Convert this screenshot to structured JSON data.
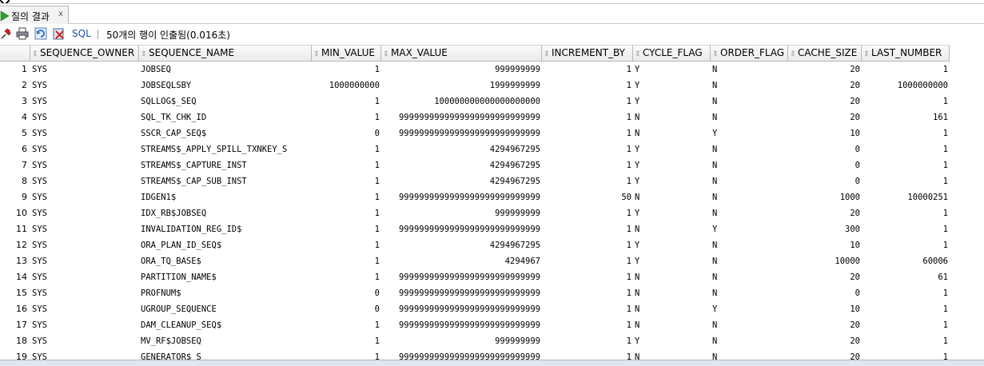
{
  "tab": {
    "title": "질의 결과",
    "close": "x"
  },
  "toolbar": {
    "sql_label": "SQL",
    "status": "50개의 행이 인출됨(0.016초)"
  },
  "columns": [
    {
      "key": "rownum",
      "label": ""
    },
    {
      "key": "owner",
      "label": "SEQUENCE_OWNER"
    },
    {
      "key": "name",
      "label": "SEQUENCE_NAME"
    },
    {
      "key": "min",
      "label": "MIN_VALUE"
    },
    {
      "key": "max",
      "label": "MAX_VALUE"
    },
    {
      "key": "inc",
      "label": "INCREMENT_BY"
    },
    {
      "key": "cycle",
      "label": "CYCLE_FLAG"
    },
    {
      "key": "order",
      "label": "ORDER_FLAG"
    },
    {
      "key": "cache",
      "label": "CACHE_SIZE"
    },
    {
      "key": "last",
      "label": "LAST_NUMBER"
    }
  ],
  "rows": [
    [
      "1",
      "SYS",
      "JOBSEQ",
      "1",
      "999999999",
      "1",
      "Y",
      "N",
      "20",
      "1"
    ],
    [
      "2",
      "SYS",
      "JOBSEQLSBY",
      "1000000000",
      "1999999999",
      "1",
      "Y",
      "N",
      "20",
      "1000000000"
    ],
    [
      "3",
      "SYS",
      "SQLLOG$_SEQ",
      "1",
      "100000000000000000000",
      "1",
      "Y",
      "N",
      "20",
      "1"
    ],
    [
      "4",
      "SYS",
      "SQL_TK_CHK_ID",
      "1",
      "9999999999999999999999999999",
      "1",
      "N",
      "N",
      "20",
      "161"
    ],
    [
      "5",
      "SYS",
      "SSCR_CAP_SEQ$",
      "0",
      "9999999999999999999999999999",
      "1",
      "N",
      "Y",
      "10",
      "1"
    ],
    [
      "6",
      "SYS",
      "STREAMS$_APPLY_SPILL_TXNKEY_S",
      "1",
      "4294967295",
      "1",
      "Y",
      "N",
      "0",
      "1"
    ],
    [
      "7",
      "SYS",
      "STREAMS$_CAPTURE_INST",
      "1",
      "4294967295",
      "1",
      "Y",
      "N",
      "0",
      "1"
    ],
    [
      "8",
      "SYS",
      "STREAMS$_CAP_SUB_INST",
      "1",
      "4294967295",
      "1",
      "Y",
      "N",
      "0",
      "1"
    ],
    [
      "9",
      "SYS",
      "IDGEN1$",
      "1",
      "9999999999999999999999999999",
      "50",
      "N",
      "N",
      "1000",
      "10000251"
    ],
    [
      "10",
      "SYS",
      "IDX_RB$JOBSEQ",
      "1",
      "999999999",
      "1",
      "Y",
      "N",
      "20",
      "1"
    ],
    [
      "11",
      "SYS",
      "INVALIDATION_REG_ID$",
      "1",
      "9999999999999999999999999999",
      "1",
      "N",
      "Y",
      "300",
      "1"
    ],
    [
      "12",
      "SYS",
      "ORA_PLAN_ID_SEQ$",
      "1",
      "4294967295",
      "1",
      "Y",
      "N",
      "10",
      "1"
    ],
    [
      "13",
      "SYS",
      "ORA_TQ_BASE$",
      "1",
      "4294967",
      "1",
      "Y",
      "N",
      "10000",
      "60006"
    ],
    [
      "14",
      "SYS",
      "PARTITION_NAME$",
      "1",
      "9999999999999999999999999999",
      "1",
      "N",
      "N",
      "20",
      "61"
    ],
    [
      "15",
      "SYS",
      "PROFNUM$",
      "0",
      "9999999999999999999999999999",
      "1",
      "N",
      "N",
      "0",
      "1"
    ],
    [
      "16",
      "SYS",
      "UGROUP_SEQUENCE",
      "0",
      "9999999999999999999999999999",
      "1",
      "N",
      "Y",
      "10",
      "1"
    ],
    [
      "17",
      "SYS",
      "DAM_CLEANUP_SEQ$",
      "1",
      "9999999999999999999999999999",
      "1",
      "N",
      "N",
      "20",
      "1"
    ],
    [
      "18",
      "SYS",
      "MV_RF$JOBSEQ",
      "1",
      "999999999",
      "1",
      "Y",
      "N",
      "20",
      "1"
    ],
    [
      "19",
      "SYS",
      "GENERATOR$_S",
      "1",
      "9999999999999999999999999999",
      "1",
      "N",
      "N",
      "20",
      "1"
    ]
  ],
  "colors": {
    "play": "#2ea12e",
    "pin": "#cc2222",
    "sql": "#1f4fa8"
  },
  "icons": [
    "pin-icon",
    "print-icon",
    "refresh-icon",
    "export-icon",
    "sql-link"
  ]
}
